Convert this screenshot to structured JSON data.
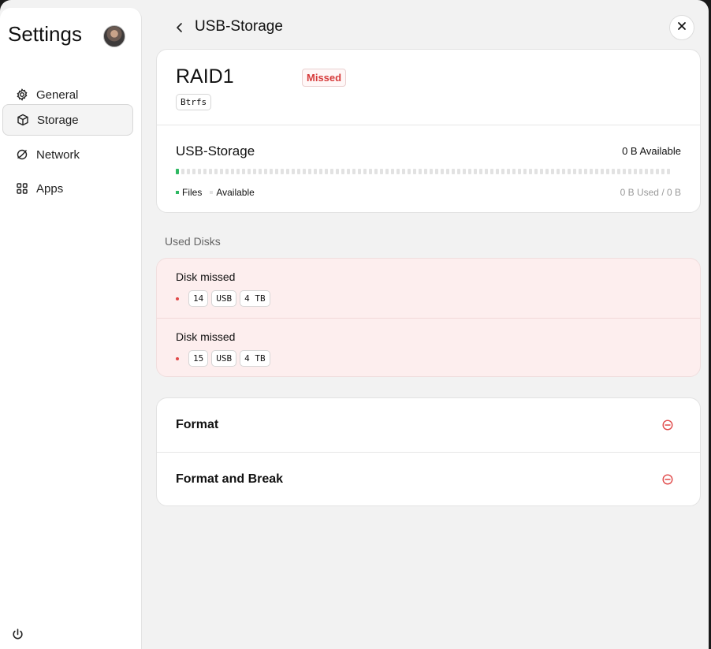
{
  "sidebar": {
    "title": "Settings",
    "items": [
      {
        "label": "General",
        "icon": "gear-icon"
      },
      {
        "label": "Storage",
        "icon": "box-icon",
        "active": true
      },
      {
        "label": "Network",
        "icon": "globe-icon"
      },
      {
        "label": "Apps",
        "icon": "grid-icon"
      }
    ]
  },
  "header": {
    "title": "USB-Storage"
  },
  "volume": {
    "name": "RAID1",
    "status": "Missed",
    "filesystem": "Btrfs",
    "storage_name": "USB-Storage",
    "available_text": "0 B Available",
    "legend_files": "Files",
    "legend_available": "Available",
    "usage_text": "0 B Used / 0 B",
    "used_fraction": 0
  },
  "used_disks": {
    "label": "Used Disks",
    "disks": [
      {
        "title": "Disk missed",
        "slot": "14",
        "bus": "USB",
        "size": "4 TB"
      },
      {
        "title": "Disk missed",
        "slot": "15",
        "bus": "USB",
        "size": "4 TB"
      }
    ]
  },
  "actions": [
    {
      "label": "Format",
      "icon": "minus-circle-icon"
    },
    {
      "label": "Format and Break",
      "icon": "minus-circle-icon"
    }
  ],
  "colors": {
    "missed_red": "#d63b3b",
    "files_green": "#2eb862",
    "disk_bg": "#fdeeee"
  }
}
